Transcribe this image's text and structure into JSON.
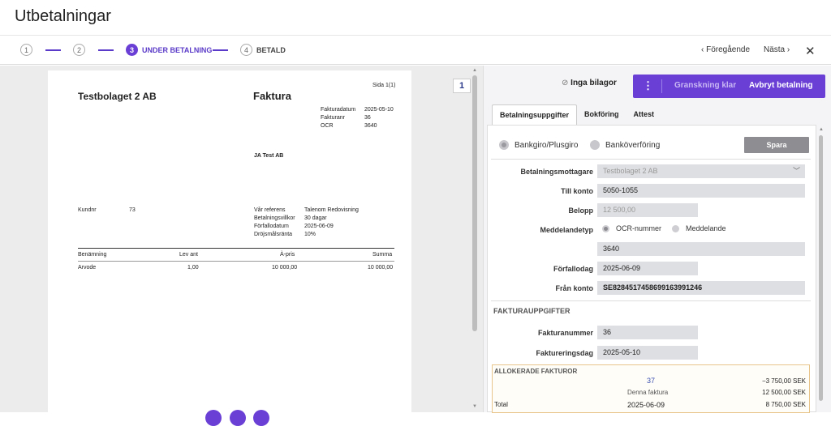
{
  "app": {
    "title": "Utbetalningar"
  },
  "steps": [
    {
      "num": "1",
      "label": ""
    },
    {
      "num": "2",
      "label": ""
    },
    {
      "num": "3",
      "label": "UNDER BETALNING"
    },
    {
      "num": "4",
      "label": "BETALD"
    }
  ],
  "nav": {
    "prev": "Föregående",
    "next": "Nästa",
    "prev_icon": "chevron-left-icon",
    "next_icon": "chevron-right-icon",
    "close_icon": "close-icon"
  },
  "viewer": {
    "page_number": "1"
  },
  "invoice": {
    "page_info": "Sida 1(1)",
    "company": "Testbolaget 2 AB",
    "doc_title": "Faktura",
    "meta": [
      {
        "label": "Fakturadatum",
        "value": "2025-05-10"
      },
      {
        "label": "Fakturanr",
        "value": "36"
      },
      {
        "label": "OCR",
        "value": "3640"
      }
    ],
    "recipient": "JA Test AB",
    "customer_label": "Kundnr",
    "customer_value": "73",
    "refs": [
      {
        "label": "Vår referens",
        "value": "Talenom Redovisning"
      },
      {
        "label": "Betalningsvillkor",
        "value": "30 dagar"
      },
      {
        "label": "Förfallodatum",
        "value": "2025-06-09"
      },
      {
        "label": "Dröjsmålsränta",
        "value": "10%"
      }
    ],
    "table_headers": [
      "Benämning",
      "Lev ant",
      "À-pris",
      "Summa"
    ],
    "rows": [
      [
        "Arvode",
        "1,00",
        "10 000,00",
        "10 000,00"
      ]
    ]
  },
  "panel": {
    "attachments": "Inga bilagor",
    "attach_icon": "paperclip-icon",
    "more_icon": "more-vertical-icon",
    "review_button": "Granskning klar",
    "cancel_button": "Avbryt betalning",
    "tabs": [
      "Betalningsuppgifter",
      "Bokföring",
      "Attest"
    ],
    "method_options": [
      "Bankgiro/Plusgiro",
      "Banköverföring"
    ],
    "save_button": "Spara",
    "labels": {
      "recipient": "Betalningsmottagare",
      "to_account": "Till konto",
      "amount": "Belopp",
      "message_type": "Meddelandetyp",
      "due_date": "Förfallodag",
      "from_account": "Från konto",
      "invoice_number": "Fakturanummer",
      "invoice_date": "Faktureringsdag"
    },
    "values": {
      "recipient": "Testbolaget 2 AB",
      "to_account": "5050-1055",
      "amount": "12 500,00",
      "message_ocr": "OCR-nummer",
      "message_msg": "Meddelande",
      "ocr_value": "3640",
      "due_date": "2025-06-09",
      "from_account": "SE8284517458699163991246",
      "invoice_number": "36",
      "invoice_date": "2025-05-10"
    },
    "section_invoice": "FAKTURAUPPGIFTER",
    "allocated": {
      "title": "ALLOKERADE FAKTUROR",
      "link": "37",
      "link_amount": "−3 750,00 SEK",
      "this_label": "Denna faktura",
      "this_amount": "12 500,00 SEK",
      "total_label": "Total",
      "total_date": "2025-06-09",
      "total_amount": "8 750,00 SEK"
    }
  }
}
